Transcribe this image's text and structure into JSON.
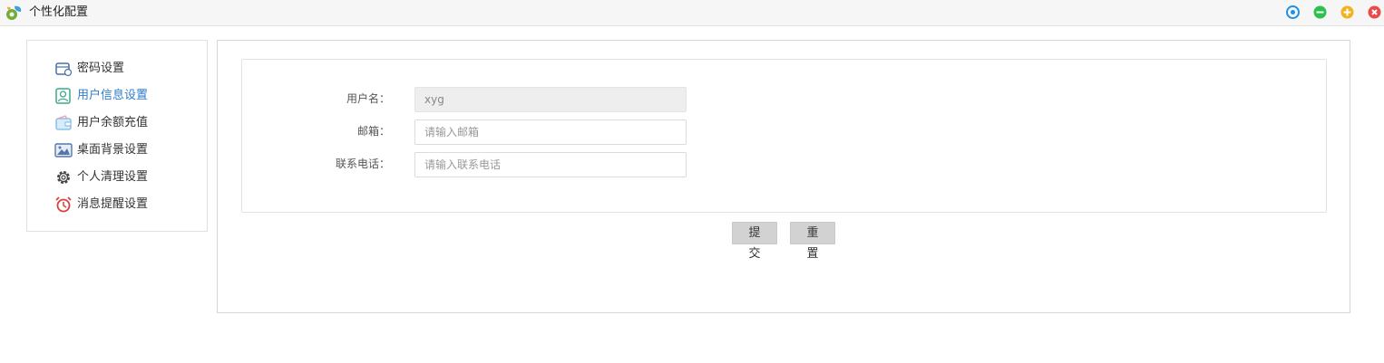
{
  "window": {
    "title": "个性化配置",
    "app_icon": "gear-leaf-icon",
    "controls": [
      {
        "name": "settings-icon",
        "color": "#1e90e6"
      },
      {
        "name": "minimize-icon",
        "color": "#2fbf4f"
      },
      {
        "name": "maximize-icon",
        "color": "#f2b21e"
      },
      {
        "name": "close-icon",
        "color": "#ea4a4a"
      }
    ]
  },
  "sidebar": {
    "items": [
      {
        "label": "密码设置",
        "icon": "wallet-lock-icon"
      },
      {
        "label": "用户信息设置",
        "icon": "user-card-icon",
        "active": true
      },
      {
        "label": "用户余额充值",
        "icon": "wallet-icon"
      },
      {
        "label": "桌面背景设置",
        "icon": "picture-icon"
      },
      {
        "label": "个人清理设置",
        "icon": "gear-icon"
      },
      {
        "label": "消息提醒设置",
        "icon": "alarm-clock-icon"
      }
    ]
  },
  "form": {
    "username_label": "用户名：",
    "username_value": "xyg",
    "email_label": "邮箱：",
    "email_placeholder": "请输入邮箱",
    "phone_label": "联系电话：",
    "phone_placeholder": "请输入联系电话",
    "submit_label": "提交",
    "reset_label": "重置"
  },
  "colors": {
    "active": "#2e7dd1",
    "button_bg": "#d2d2d2"
  }
}
